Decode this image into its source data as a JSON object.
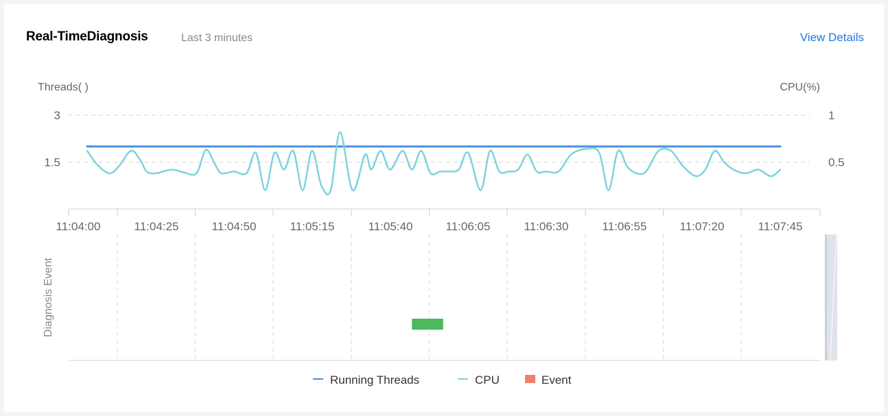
{
  "header": {
    "title": "Real-TimeDiagnosis",
    "subtitle": "Last 3 minutes",
    "view_details": "View Details"
  },
  "colors": {
    "running_threads": "#4a90e2",
    "cpu": "#7dd3df",
    "event_legend": "#f0826b",
    "event_bar": "#4db85e",
    "grid": "#cccccc",
    "axis_text": "#666666"
  },
  "chart_data": {
    "type": "line",
    "y_left_label": "Threads( )",
    "y_right_label": "CPU(%)",
    "y_left_ticks": [
      "3",
      "1.5"
    ],
    "y_right_ticks": [
      "1",
      "0.5"
    ],
    "y_left_range": [
      0,
      3
    ],
    "y_right_range": [
      0,
      1
    ],
    "x_ticks": [
      "11:04:00",
      "11:04:25",
      "11:04:50",
      "11:05:15",
      "11:05:40",
      "11:06:05",
      "11:06:30",
      "11:06:55",
      "11:07:20",
      "11:07:45"
    ],
    "x_range": [
      0,
      225
    ],
    "series": [
      {
        "name": "Running Threads",
        "axis": "left",
        "x": [
          3,
          225
        ],
        "y": [
          2,
          2
        ]
      },
      {
        "name": "CPU",
        "axis": "right",
        "x": [
          3,
          6,
          10,
          13,
          17,
          20,
          22,
          25,
          30,
          34,
          38,
          41,
          44,
          46,
          50,
          54,
          57,
          60,
          63,
          66,
          69,
          72,
          75,
          78,
          81,
          84,
          88,
          92,
          94,
          97,
          100,
          104,
          107,
          110,
          113,
          116,
          119,
          122,
          125,
          129,
          132,
          135,
          138,
          141,
          144,
          147,
          150,
          154,
          158,
          163,
          167,
          170,
          173,
          176,
          179,
          182,
          186,
          190,
          194,
          198,
          201,
          204,
          207,
          210,
          214,
          218,
          222,
          225
        ],
        "y": [
          0.62,
          0.48,
          0.38,
          0.45,
          0.62,
          0.52,
          0.4,
          0.38,
          0.42,
          0.39,
          0.38,
          0.63,
          0.47,
          0.38,
          0.4,
          0.38,
          0.6,
          0.2,
          0.6,
          0.42,
          0.62,
          0.2,
          0.62,
          0.25,
          0.2,
          0.82,
          0.2,
          0.58,
          0.42,
          0.62,
          0.42,
          0.62,
          0.42,
          0.62,
          0.38,
          0.4,
          0.4,
          0.42,
          0.6,
          0.2,
          0.62,
          0.4,
          0.4,
          0.42,
          0.58,
          0.4,
          0.4,
          0.4,
          0.58,
          0.64,
          0.6,
          0.2,
          0.62,
          0.45,
          0.38,
          0.4,
          0.62,
          0.62,
          0.45,
          0.35,
          0.42,
          0.62,
          0.5,
          0.42,
          0.38,
          0.42,
          0.35,
          0.42
        ]
      }
    ],
    "events": {
      "label": "Diagnosis Event",
      "items": [
        {
          "start": 107,
          "end": 117
        }
      ]
    }
  },
  "legend": {
    "items": [
      {
        "label": "Running Threads",
        "kind": "line",
        "color_key": "running_threads"
      },
      {
        "label": "CPU",
        "kind": "line",
        "color_key": "cpu"
      },
      {
        "label": "Event",
        "kind": "rect",
        "color_key": "event_legend"
      }
    ]
  }
}
